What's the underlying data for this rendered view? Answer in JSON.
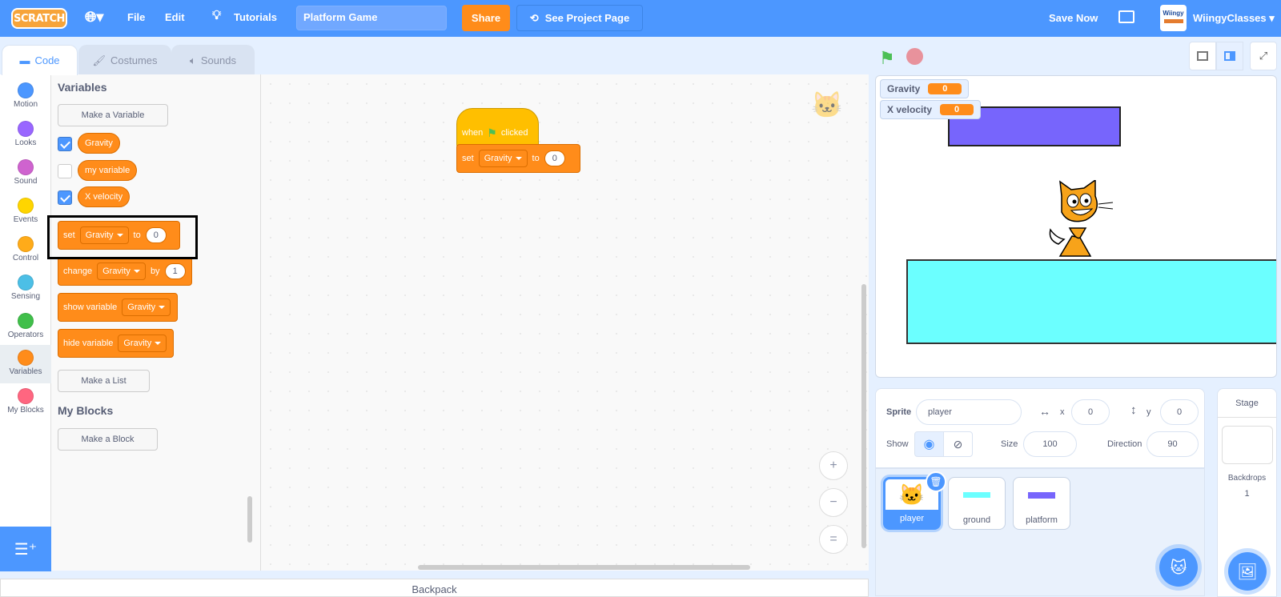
{
  "menubar": {
    "logo": "SCRATCH",
    "file": "File",
    "edit": "Edit",
    "tutorials": "Tutorials",
    "project_title": "Platform Game",
    "share": "Share",
    "see_project_page": "See Project Page",
    "save_now": "Save Now",
    "avatar_text": "Wiingy",
    "username": "WiingyClasses"
  },
  "tabs": [
    {
      "label": "Code",
      "icon": "code-icon"
    },
    {
      "label": "Costumes",
      "icon": "brush-icon"
    },
    {
      "label": "Sounds",
      "icon": "speaker-icon"
    }
  ],
  "categories": [
    {
      "label": "Motion",
      "color": "#4c97ff"
    },
    {
      "label": "Looks",
      "color": "#9966ff"
    },
    {
      "label": "Sound",
      "color": "#cf63cf"
    },
    {
      "label": "Events",
      "color": "#ffd500"
    },
    {
      "label": "Control",
      "color": "#ffab19"
    },
    {
      "label": "Sensing",
      "color": "#4cbfe6"
    },
    {
      "label": "Operators",
      "color": "#40bf4a"
    },
    {
      "label": "Variables",
      "color": "#ff8c1a"
    },
    {
      "label": "My Blocks",
      "color": "#ff6680"
    }
  ],
  "palette": {
    "heading": "Variables",
    "make_variable": "Make a Variable",
    "variables": [
      {
        "name": "Gravity",
        "checked": true
      },
      {
        "name": "my variable",
        "checked": false
      },
      {
        "name": "X velocity",
        "checked": true
      }
    ],
    "set_block": {
      "verb": "set",
      "var": "Gravity",
      "to": "to",
      "value": "0"
    },
    "change_block": {
      "verb": "change",
      "var": "Gravity",
      "by": "by",
      "value": "1"
    },
    "show_block": {
      "verb": "show variable",
      "var": "Gravity"
    },
    "hide_block": {
      "verb": "hide variable",
      "var": "Gravity"
    },
    "make_list": "Make a List",
    "myblocks_heading": "My Blocks",
    "make_block": "Make a Block"
  },
  "workspace": {
    "hat": {
      "when": "when",
      "clicked": "clicked"
    },
    "set_block": {
      "verb": "set",
      "var": "Gravity",
      "to": "to",
      "value": "0"
    },
    "zoom_in": "+",
    "zoom_out": "−",
    "reset": "="
  },
  "backpack": "Backpack",
  "stage": {
    "monitors": [
      {
        "label": "Gravity",
        "value": "0"
      },
      {
        "label": "X velocity",
        "value": "0"
      }
    ],
    "platform_color": "#7765fc",
    "ground_color": "#6bffff"
  },
  "sprite_info": {
    "sprite_label": "Sprite",
    "sprite_name": "player",
    "x_label": "x",
    "x": "0",
    "y_label": "y",
    "y": "0",
    "show_label": "Show",
    "size_label": "Size",
    "size": "100",
    "direction_label": "Direction",
    "direction": "90"
  },
  "sprites": [
    {
      "name": "player",
      "selected": true
    },
    {
      "name": "ground",
      "selected": false
    },
    {
      "name": "platform",
      "selected": false
    }
  ],
  "stage_pane": {
    "label": "Stage",
    "backdrops_label": "Backdrops",
    "backdrops_count": "1"
  }
}
